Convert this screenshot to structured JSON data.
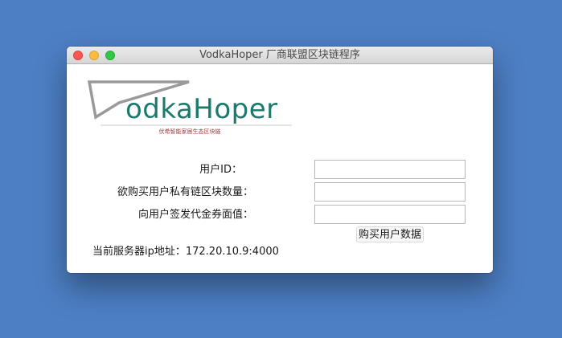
{
  "window": {
    "title": "VodkaHoper 厂商联盟区块链程序"
  },
  "logo": {
    "wordmark": "odkaHoper",
    "tagline": "伏希智能家居生态区块链",
    "colors": {
      "wordmark": "#1b7a6c",
      "v_mark": "#9a9a9a",
      "tagline": "#9a4040"
    }
  },
  "form": {
    "user_id_label": "用户ID：",
    "user_id_value": "",
    "blocks_label": "欲购买用户私有链区块数量：",
    "blocks_value": "",
    "voucher_label": "向用户签发代金券面值：",
    "voucher_value": "",
    "buy_button_label": "购买用户数据"
  },
  "status": {
    "server_info": "当前服务器ip地址：172.20.10.9:4000"
  }
}
